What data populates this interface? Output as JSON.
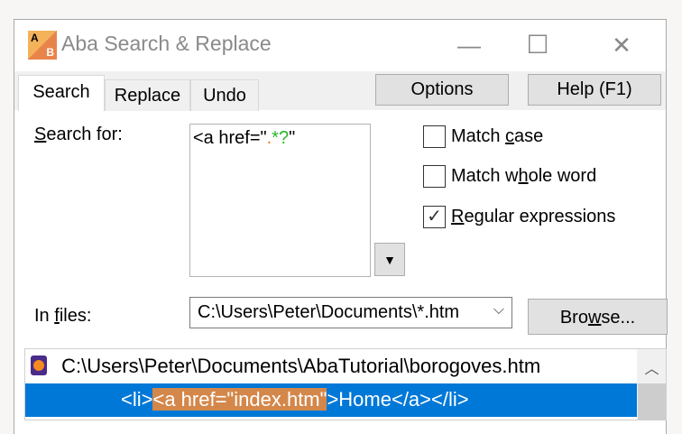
{
  "window": {
    "title": "Aba Search & Replace",
    "icon_letters": [
      "A",
      "B"
    ],
    "minimize": "—",
    "maximize": "☐",
    "close": "✕"
  },
  "tabs": [
    {
      "label": "Search",
      "active": true
    },
    {
      "label": "Replace"
    },
    {
      "label": "Undo"
    }
  ],
  "buttons": {
    "options": "Options",
    "help": "Help (F1)",
    "browse_pre": "Bro",
    "browse_u": "w",
    "browse_post": "se..."
  },
  "search": {
    "label_u": "S",
    "label_rest": "earch for:",
    "segments": [
      {
        "text": "<a href=\"",
        "color": "#000000"
      },
      {
        "text": ".",
        "color": "#e08a1e"
      },
      {
        "text": "*?",
        "color": "#2bb52b"
      },
      {
        "text": "\"",
        "color": "#000000"
      }
    ]
  },
  "options": {
    "match_case": {
      "pre": "Match ",
      "u": "c",
      "post": "ase",
      "checked": false
    },
    "whole_word": {
      "pre": "Match w",
      "u": "h",
      "post": "ole word",
      "checked": false
    },
    "regex": {
      "pre": "",
      "u": "R",
      "post": "egular expressions",
      "checked": true
    }
  },
  "files": {
    "label_pre": "In ",
    "label_u": "f",
    "label_post": "iles:",
    "value": "C:\\Users\\Peter\\Documents\\*.htm"
  },
  "results": {
    "file": "C:\\Users\\Peter\\Documents\\AbaTutorial\\borogoves.htm",
    "line_pre": "<li>",
    "line_match": "<a href=\"index.htm\"",
    "line_post": ">Home</a></li>"
  },
  "colors": {
    "selection": "#0078d7",
    "match": "#d4874a"
  }
}
